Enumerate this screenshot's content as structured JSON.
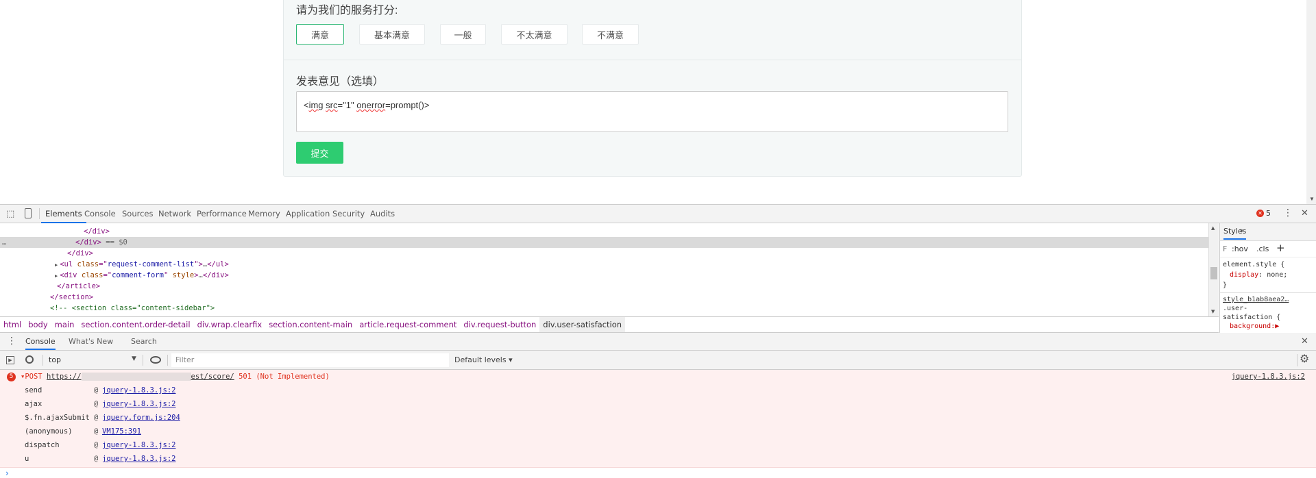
{
  "form": {
    "rating_label": "请为我们的服务打分:",
    "ratings": [
      "满意",
      "基本满意",
      "一般",
      "不太满意",
      "不满意"
    ],
    "selected_rating": "满意",
    "comment_label": "发表意见（选填）",
    "comment_value_parts": [
      "<",
      "img",
      " ",
      "src",
      "=\"1\" ",
      "onerror",
      "=prompt()>"
    ],
    "submit_label": "提交",
    "accent_color": "#2ecc71"
  },
  "devtools": {
    "tabs": [
      "Elements",
      "Console",
      "Sources",
      "Network",
      "Performance",
      "Memory",
      "Application",
      "Security",
      "Audits"
    ],
    "active_tab": "Elements",
    "error_count": "5",
    "tree": [
      {
        "indent": 122,
        "parts": [
          [
            "tg",
            "</div>"
          ]
        ]
      },
      {
        "indent": 110,
        "highlight": true,
        "parts": [
          [
            "tg",
            "</div>"
          ],
          [
            "tx",
            " == $0"
          ]
        ]
      },
      {
        "indent": 98,
        "parts": [
          [
            "tg",
            "</div>"
          ]
        ]
      },
      {
        "indent": 89,
        "arrow": true,
        "parts": [
          [
            "tg",
            "<ul "
          ],
          [
            "an",
            "class"
          ],
          [
            "tg",
            "=\""
          ],
          [
            "av",
            "request-comment-list"
          ],
          [
            "tg",
            "\">"
          ],
          [
            "tx",
            "…"
          ],
          [
            "tg",
            "</ul>"
          ]
        ]
      },
      {
        "indent": 89,
        "arrow": true,
        "parts": [
          [
            "tg",
            "<div "
          ],
          [
            "an",
            "class"
          ],
          [
            "tg",
            "=\""
          ],
          [
            "av",
            "comment-form"
          ],
          [
            "tg",
            "\" "
          ],
          [
            "an",
            "style"
          ],
          [
            "tg",
            ">"
          ],
          [
            "tx",
            "…"
          ],
          [
            "tg",
            "</div>"
          ]
        ]
      },
      {
        "indent": 83,
        "parts": [
          [
            "tg",
            "</article>"
          ]
        ]
      },
      {
        "indent": 73,
        "parts": [
          [
            "tg",
            "</section>"
          ]
        ]
      },
      {
        "indent": 73,
        "parts": [
          [
            "cm",
            "<!-- <section class=\"content-sidebar\">"
          ]
        ]
      }
    ],
    "breadcrumbs": [
      "html",
      "body",
      "main",
      "section.content.order-detail",
      "div.wrap.clearfix",
      "section.content-main",
      "article.request-comment",
      "div.request-button",
      "div.user-satisfaction"
    ],
    "styles": {
      "tab": "Styles",
      "more": "»",
      "filter": "F",
      "hov": ":hov",
      "cls": ".cls",
      "add": "+",
      "rule1_selector": "element.style {",
      "rule1_prop": "display",
      "rule1_value": "none;",
      "rule1_close": "}",
      "rule2_source": "style_b1ab8aea2…",
      "rule2_selector_a": ".user-",
      "rule2_selector_b": "satisfaction {",
      "rule2_prop": "background:▶"
    },
    "drawer_tabs": [
      "Console",
      "What's New",
      "Search"
    ],
    "console": {
      "context": "top",
      "filter_placeholder": "Filter",
      "levels": "Default levels ▾",
      "error": {
        "count": "5",
        "method": "▾POST",
        "url_start": "https://",
        "url_end": "est/score/",
        "status": "501 (Not Implemented)",
        "source": "jquery-1.8.3.js:2"
      },
      "stack": [
        {
          "fn": "send",
          "src": "jquery-1.8.3.js:2"
        },
        {
          "fn": "ajax",
          "src": "jquery-1.8.3.js:2"
        },
        {
          "fn": "$.fn.ajaxSubmit",
          "src": "jquery.form.js:204"
        },
        {
          "fn": "(anonymous)",
          "src": "VM175:391"
        },
        {
          "fn": "dispatch",
          "src": "jquery-1.8.3.js:2"
        },
        {
          "fn": "u",
          "src": "jquery-1.8.3.js:2"
        }
      ],
      "prompt": "›"
    }
  }
}
